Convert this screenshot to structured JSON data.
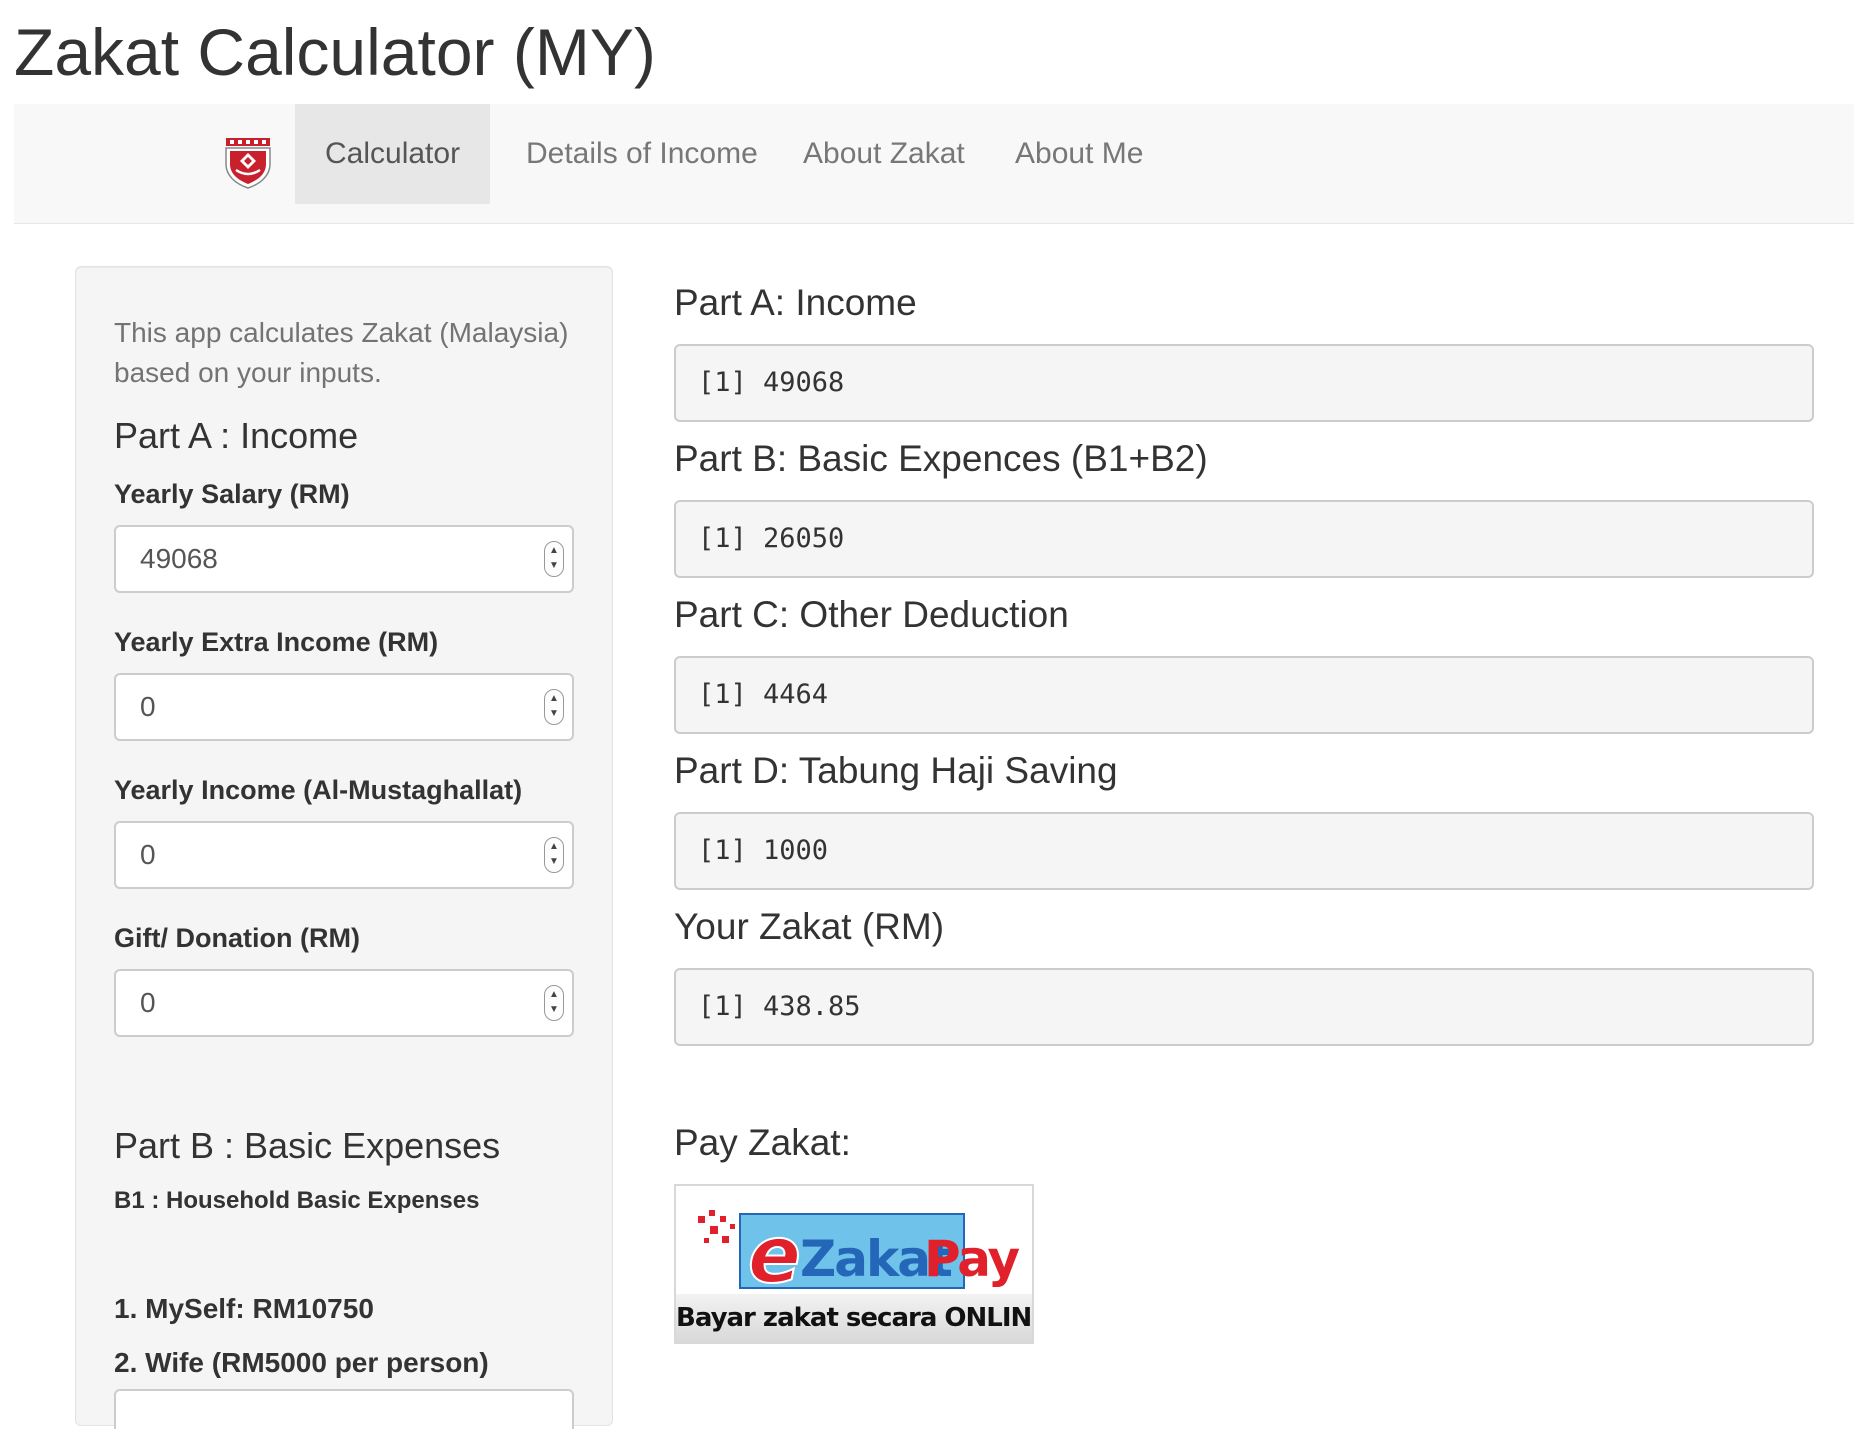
{
  "app": {
    "title": "Zakat Calculator (MY)"
  },
  "nav": {
    "tabs": [
      {
        "label": "Calculator",
        "active": true
      },
      {
        "label": "Details of Income",
        "active": false
      },
      {
        "label": "About Zakat",
        "active": false
      },
      {
        "label": "About Me",
        "active": false
      }
    ]
  },
  "sidebar": {
    "intro": "This app calculates Zakat (Malaysia) based on your inputs.",
    "part_a": {
      "heading": "Part A : Income",
      "fields": [
        {
          "label": "Yearly Salary (RM)",
          "value": "49068"
        },
        {
          "label": "Yearly Extra Income (RM)",
          "value": "0"
        },
        {
          "label": "Yearly Income (Al-Mustaghallat)",
          "value": "0"
        },
        {
          "label": "Gift/ Donation (RM)",
          "value": "0"
        }
      ]
    },
    "part_b": {
      "heading": "Part B : Basic Expenses",
      "subheading": "B1 : Household Basic Expenses",
      "items": [
        "1. MySelf: RM10750",
        "2. Wife (RM5000 per person)"
      ]
    }
  },
  "results": [
    {
      "heading": "Part A: Income",
      "output": "[1] 49068"
    },
    {
      "heading": "Part B: Basic Expences (B1+B2)",
      "output": "[1] 26050"
    },
    {
      "heading": "Part C: Other Deduction",
      "output": "[1] 4464"
    },
    {
      "heading": "Part D: Tabung Haji Saving",
      "output": "[1] 1000"
    },
    {
      "heading": "Your Zakat (RM)",
      "output": "[1] 438.85"
    }
  ],
  "pay": {
    "heading": "Pay Zakat:",
    "banner_e": "e",
    "banner_zakat": "Zakat",
    "banner_pay": "Pay",
    "banner_tagline": "Bayar zakat secara ONLINE"
  },
  "colors": {
    "navbar_bg": "#f8f8f8",
    "active_tab_bg": "#e7e7e7",
    "well_bg": "#f5f5f5",
    "ezakat_red": "#e0202a",
    "ezakat_blue": "#2466b8"
  }
}
